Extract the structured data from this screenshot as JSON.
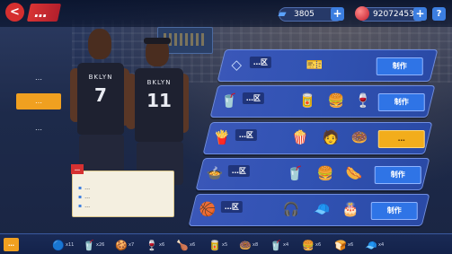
{
  "header": {
    "logo_glyph": "<",
    "title": "…",
    "currency_1": {
      "icon": "ticket-icon",
      "value": "3805"
    },
    "currency_2": {
      "icon": "ball-icon",
      "value": "92072453"
    },
    "plus_glyph": "+",
    "help_glyph": "?"
  },
  "tabs": [
    {
      "label": "…"
    },
    {
      "label": "…"
    },
    {
      "label": "…"
    }
  ],
  "players": [
    {
      "team": "BKLYN",
      "number": "7"
    },
    {
      "team": "BKLYN",
      "number": "11"
    }
  ],
  "tooltip": {
    "tag": "…",
    "lines": [
      "…",
      "…",
      "…"
    ]
  },
  "rows": [
    {
      "title": "…区",
      "badge": "◇",
      "items": [
        "🎫"
      ],
      "button": "制作",
      "button_style": "blue"
    },
    {
      "title": "…区",
      "badge": "🥤",
      "items": [
        "🥫",
        "🍔",
        "🍷"
      ],
      "button": "制作",
      "button_style": "blue"
    },
    {
      "title": "…区",
      "badge": "🍟",
      "items": [
        "🍿",
        "🧑",
        "🍩"
      ],
      "button": "…",
      "button_style": "gold"
    },
    {
      "title": "…区",
      "badge": "🍲",
      "items": [
        "🥤",
        "🍔",
        "🌭"
      ],
      "button": "制作",
      "button_style": "blue"
    },
    {
      "title": "…区",
      "badge": "🏀",
      "items": [
        "🎧",
        "🧢",
        "🎂"
      ],
      "button": "制作",
      "button_style": "blue"
    }
  ],
  "bottom": {
    "label": "…",
    "items": [
      {
        "icon": "🔵",
        "count": "x11"
      },
      {
        "icon": "🥤",
        "count": "x26"
      },
      {
        "icon": "🍪",
        "count": "x7"
      },
      {
        "icon": "🍷",
        "count": "x6"
      },
      {
        "icon": "🍗",
        "count": "x6"
      },
      {
        "icon": "🥫",
        "count": "x5"
      },
      {
        "icon": "🍩",
        "count": "x8"
      },
      {
        "icon": "🥤",
        "count": "x4"
      },
      {
        "icon": "🍔",
        "count": "x6"
      },
      {
        "icon": "🍞",
        "count": "x6"
      },
      {
        "icon": "🧢",
        "count": "x4"
      }
    ]
  },
  "colors": {
    "accent_gold": "#f0a020",
    "accent_red": "#d83434",
    "row_blue": "#3253b4",
    "button_blue": "#2f74e6"
  }
}
